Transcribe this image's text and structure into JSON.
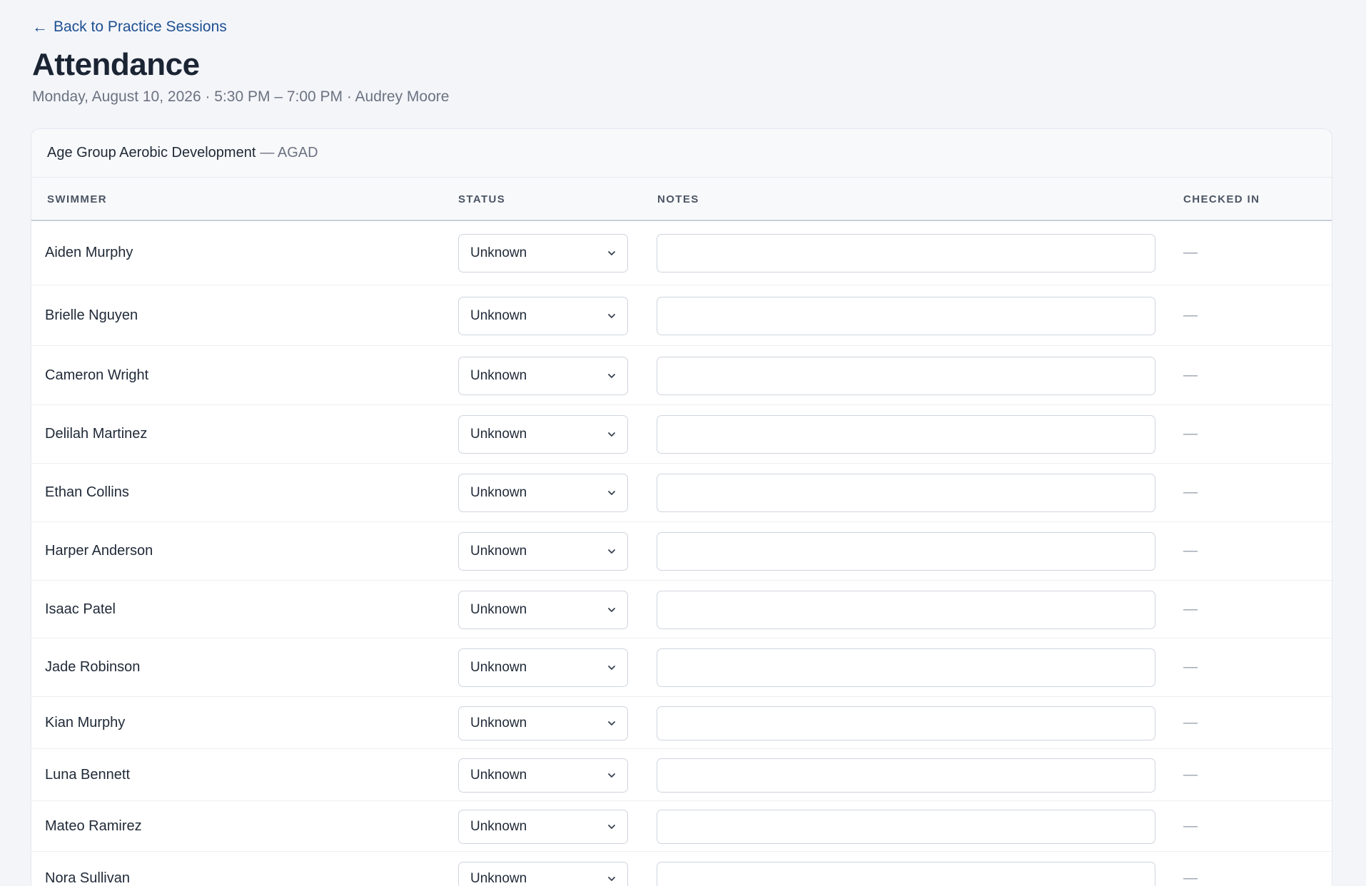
{
  "nav": {
    "back_arrow": "←",
    "back_label": "Back to Practice Sessions"
  },
  "page": {
    "title": "Attendance",
    "subtitle": "Monday, August 10, 2026 · 5:30 PM – 7:00 PM · Audrey Moore"
  },
  "group": {
    "name": "Age Group Aerobic Development",
    "code": "— AGAD"
  },
  "table": {
    "headers": {
      "swimmer": "SWIMMER",
      "status": "STATUS",
      "notes": "NOTES",
      "checked_in": "CHECKED IN"
    },
    "rows": [
      {
        "swimmer": "Aiden Murphy",
        "status": "Unknown",
        "notes": "",
        "checked_in": "—"
      },
      {
        "swimmer": "Brielle Nguyen",
        "status": "Unknown",
        "notes": "",
        "checked_in": "—"
      },
      {
        "swimmer": "Cameron Wright",
        "status": "Unknown",
        "notes": "",
        "checked_in": "—"
      },
      {
        "swimmer": "Delilah Martinez",
        "status": "Unknown",
        "notes": "",
        "checked_in": "—"
      },
      {
        "swimmer": "Ethan Collins",
        "status": "Unknown",
        "notes": "",
        "checked_in": "—"
      },
      {
        "swimmer": "Harper Anderson",
        "status": "Unknown",
        "notes": "",
        "checked_in": "—"
      },
      {
        "swimmer": "Isaac Patel",
        "status": "Unknown",
        "notes": "",
        "checked_in": "—"
      },
      {
        "swimmer": "Jade Robinson",
        "status": "Unknown",
        "notes": "",
        "checked_in": "—"
      },
      {
        "swimmer": "Kian Murphy",
        "status": "Unknown",
        "notes": "",
        "checked_in": "—"
      },
      {
        "swimmer": "Luna Bennett",
        "status": "Unknown",
        "notes": "",
        "checked_in": "—"
      },
      {
        "swimmer": "Mateo Ramirez",
        "status": "Unknown",
        "notes": "",
        "checked_in": "—"
      },
      {
        "swimmer": "Nora Sullivan",
        "status": "Unknown",
        "notes": "",
        "checked_in": "—"
      }
    ]
  },
  "colors": {
    "link": "#1e4f91",
    "background": "#f3f5f9",
    "card": "#ffffff",
    "muted": "#6b7280"
  }
}
